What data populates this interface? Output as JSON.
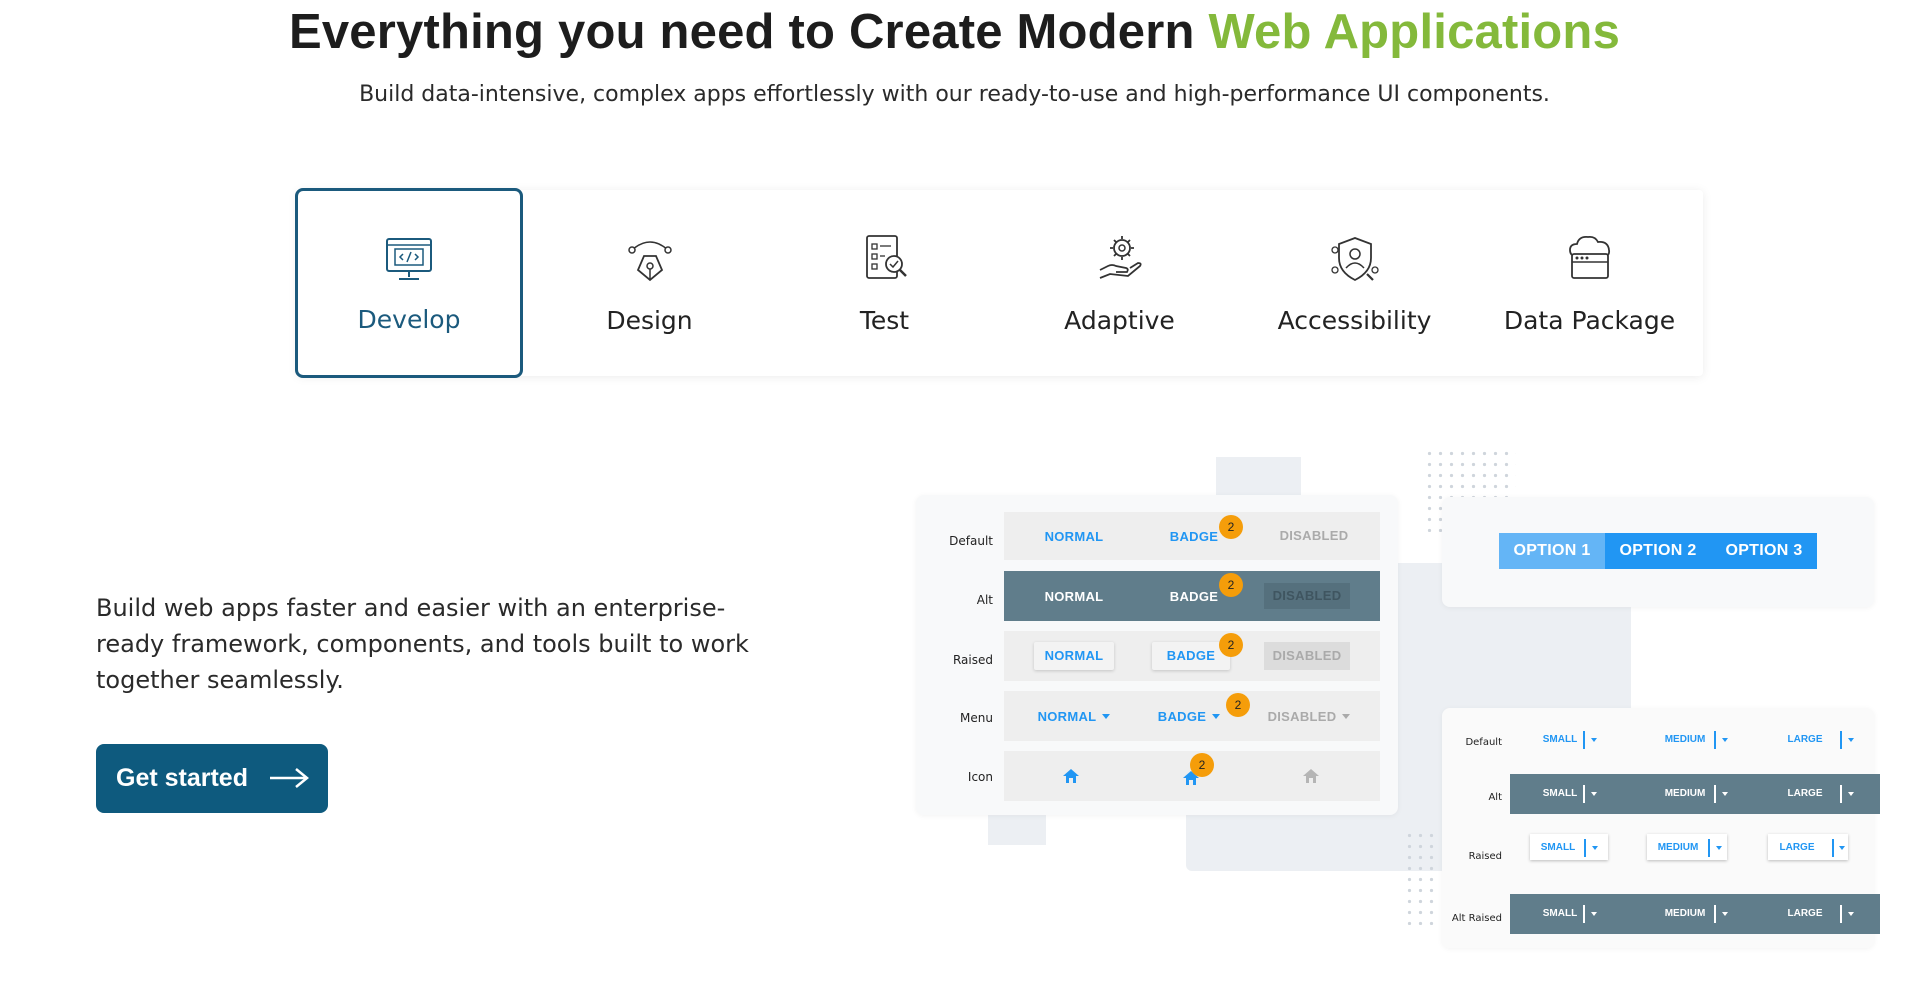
{
  "hero": {
    "title_main": "Everything you need to Create Modern ",
    "title_accent": "Web Applications",
    "subtitle": "Build data-intensive, complex apps effortlessly with our ready-to-use and high-performance UI components."
  },
  "tabs": [
    {
      "label": "Develop",
      "icon": "code-monitor-icon",
      "active": true
    },
    {
      "label": "Design",
      "icon": "pen-tool-icon",
      "active": false
    },
    {
      "label": "Test",
      "icon": "checklist-search-icon",
      "active": false
    },
    {
      "label": "Adaptive",
      "icon": "hand-gear-icon",
      "active": false
    },
    {
      "label": "Accessibility",
      "icon": "user-shield-icon",
      "active": false
    },
    {
      "label": "Data Package",
      "icon": "cloud-database-icon",
      "active": false
    }
  ],
  "content": {
    "body": "Build web apps faster and easier with an enterprise-ready framework, components, and tools built to work together seamlessly.",
    "cta": "Get started"
  },
  "button_demo": {
    "row_labels": [
      "Default",
      "Alt",
      "Raised",
      "Menu",
      "Icon"
    ],
    "normal": "NORMAL",
    "badge": "BADGE",
    "disabled": "DISABLED",
    "badge_count": "2"
  },
  "segmented": {
    "options": [
      "OPTION 1",
      "OPTION 2",
      "OPTION 3"
    ],
    "colors": {
      "first": "#64b5f6",
      "rest": "#2196f3"
    }
  },
  "split_demo": {
    "row_labels": [
      "Default",
      "Alt",
      "Raised",
      "Alt Raised"
    ],
    "sizes": [
      "SMALL",
      "MEDIUM",
      "LARGE"
    ]
  },
  "colors": {
    "accent_green": "#84b93b",
    "brand_blue": "#0e5a7e",
    "component_blue": "#2196f3",
    "badge_orange": "#f59d0a",
    "alt_row": "#607d8b"
  }
}
